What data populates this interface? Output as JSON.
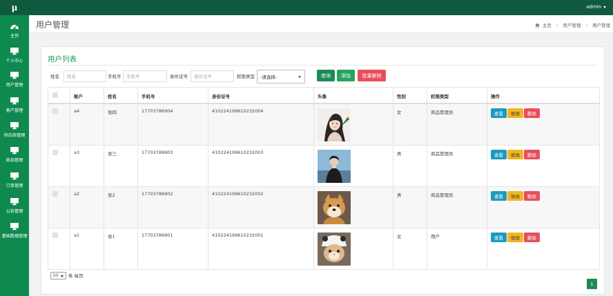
{
  "app": {
    "logo": "μ",
    "user": "admin"
  },
  "sidebar": {
    "items": [
      {
        "label": "主页",
        "icon": "dashboard-icon"
      },
      {
        "label": "个人中心",
        "icon": "monitor-icon"
      },
      {
        "label": "用户管理",
        "icon": "monitor-icon"
      },
      {
        "label": "客户管理",
        "icon": "monitor-icon"
      },
      {
        "label": "供应商管理",
        "icon": "monitor-icon"
      },
      {
        "label": "商品管理",
        "icon": "monitor-icon"
      },
      {
        "label": "订单管理",
        "icon": "monitor-icon"
      },
      {
        "label": "公告管理",
        "icon": "monitor-icon"
      },
      {
        "label": "基础数据管理",
        "icon": "monitor-icon"
      }
    ]
  },
  "header": {
    "title": "用户管理",
    "breadcrumb": [
      "主页",
      "用户管理",
      "用户管理"
    ]
  },
  "card": {
    "title": "用户列表"
  },
  "search": {
    "name_label": "姓名",
    "name_placeholder": "姓名",
    "phone_label": "手机号",
    "phone_placeholder": "手机号",
    "id_label": "身份证号",
    "id_placeholder": "身份证号",
    "role_label": "权限类型",
    "role_value": "-请选择-",
    "query_label": "查询",
    "add_label": "添加",
    "batch_delete_label": "批量删除"
  },
  "table": {
    "headers": [
      "账户",
      "姓名",
      "手机号",
      "身份证号",
      "头像",
      "性别",
      "权限类型",
      "操作"
    ],
    "action_labels": {
      "view": "查看",
      "edit": "修改",
      "delete": "删除"
    },
    "rows": [
      {
        "account": "a4",
        "name": "张四",
        "phone": "17703786904",
        "id_number": "410224199610232004",
        "avatar": "illustrated-girl-avatar",
        "gender": "女",
        "role": "商品管理员"
      },
      {
        "account": "a3",
        "name": "张三",
        "phone": "17703786903",
        "id_number": "410224199610232003",
        "avatar": "man-in-black-avatar",
        "gender": "男",
        "role": "商品管理员"
      },
      {
        "account": "a2",
        "name": "张2",
        "phone": "17703786902",
        "id_number": "410224199610232002",
        "avatar": "shiba-dog-avatar",
        "gender": "男",
        "role": "商品管理员"
      },
      {
        "account": "a1",
        "name": "张1",
        "phone": "17703786901",
        "id_number": "410224199610232001",
        "avatar": "cat-in-hat-avatar",
        "gender": "女",
        "role": "用户"
      }
    ]
  },
  "pager": {
    "page_size": "10",
    "per_page_label": "条 每页",
    "current_page": "1"
  },
  "colors": {
    "topbar": "#0f5a3e",
    "sidebar": "#0e8a4f",
    "accent": "#1d8a55",
    "danger": "#e84d5c",
    "info": "#1c9bc0",
    "warning": "#f3b522"
  }
}
